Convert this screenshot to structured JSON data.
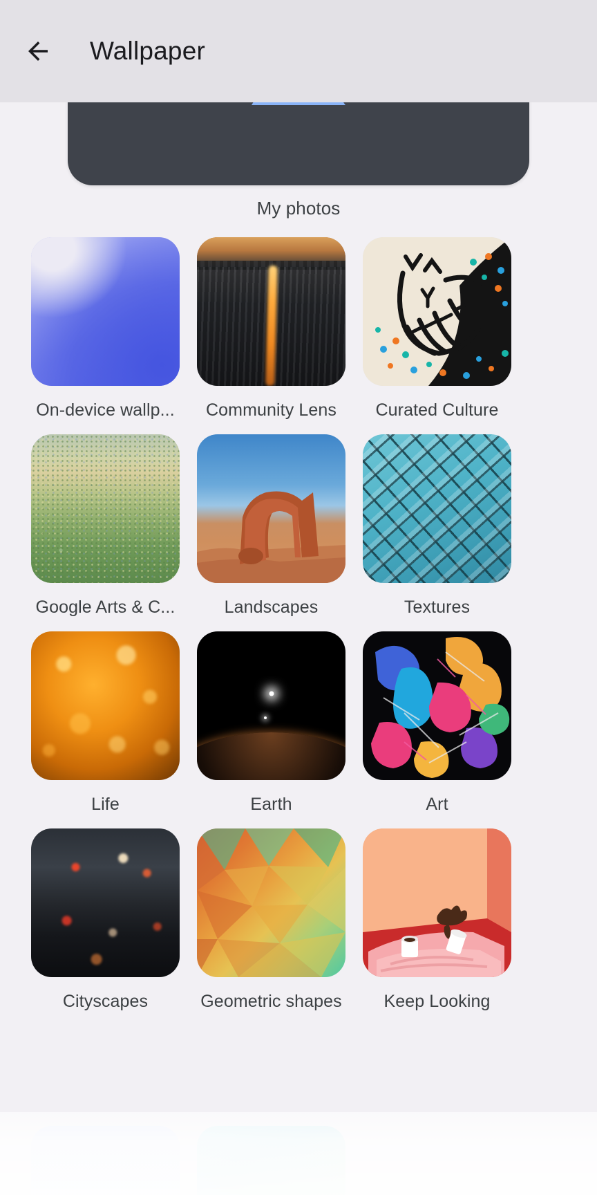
{
  "app": {
    "screen_title": "Wallpaper",
    "background_color": "#f2f0f4",
    "appbar_color": "#e3e1e6",
    "text_color": "#3c4043"
  },
  "appbar": {
    "back_label": "Back",
    "back_icon": "arrow-left-icon",
    "title": "Wallpaper"
  },
  "hero": {
    "label": "My photos",
    "icon": "photo-mountain-icon",
    "card_color": "#3f434b",
    "icon_color": "#8ab4f8"
  },
  "grid": {
    "columns": 3,
    "items": [
      {
        "label": "On-device wallp...",
        "full_label": "On-device wallpapers",
        "art": "art-ondevice",
        "row": 1,
        "col": 1
      },
      {
        "label": "Community Lens",
        "art": "art-community",
        "row": 1,
        "col": 2
      },
      {
        "label": "Curated Culture",
        "art": "art-culture",
        "row": 1,
        "col": 3
      },
      {
        "label": "Google Arts & C...",
        "full_label": "Google Arts & Culture",
        "art": "art-arts",
        "row": 2,
        "col": 1
      },
      {
        "label": "Landscapes",
        "art": "art-landscapes",
        "row": 2,
        "col": 2
      },
      {
        "label": "Textures",
        "art": "art-textures",
        "row": 2,
        "col": 3
      },
      {
        "label": "Life",
        "art": "art-life",
        "row": 3,
        "col": 1
      },
      {
        "label": "Earth",
        "art": "art-earth",
        "row": 3,
        "col": 2
      },
      {
        "label": "Art",
        "art": "art-art",
        "row": 3,
        "col": 3
      },
      {
        "label": "Cityscapes",
        "art": "art-city",
        "row": 4,
        "col": 1
      },
      {
        "label": "Geometric shapes",
        "art": "art-geo",
        "row": 4,
        "col": 2
      },
      {
        "label": "Keep Looking",
        "art": "art-keep",
        "row": 4,
        "col": 3
      }
    ],
    "partial_row": [
      {
        "label": "",
        "art": "art-partial-1"
      },
      {
        "label": "",
        "art": "art-partial-2"
      }
    ]
  }
}
